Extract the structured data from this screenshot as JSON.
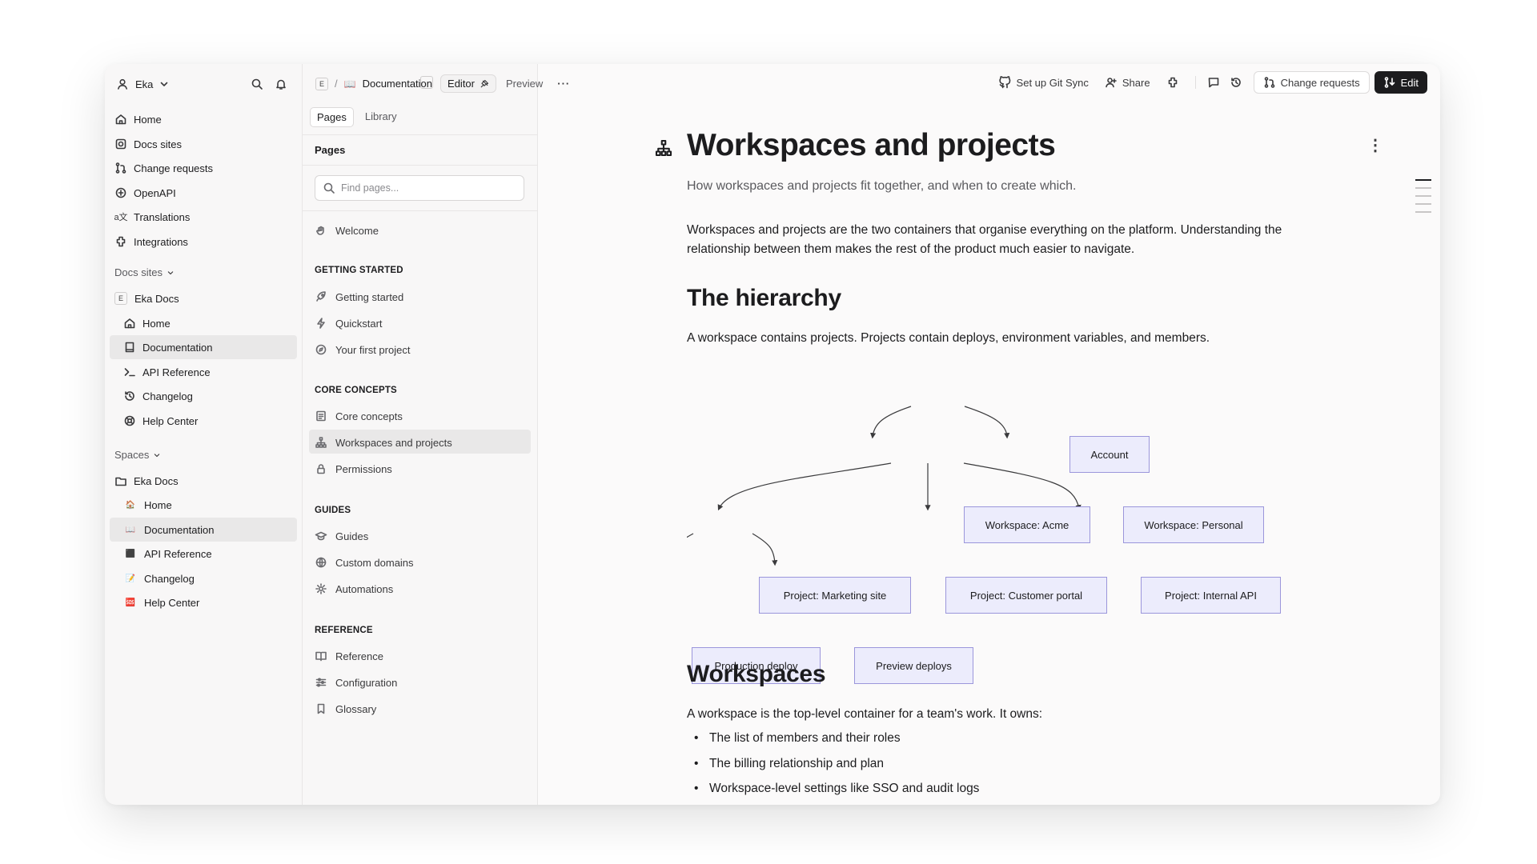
{
  "user": {
    "name": "Eka"
  },
  "sidebar": {
    "nav": [
      {
        "label": "Home",
        "icon": "home-icon"
      },
      {
        "label": "Docs sites",
        "icon": "docs-sites-icon"
      },
      {
        "label": "Change requests",
        "icon": "change-requests-icon"
      },
      {
        "label": "OpenAPI",
        "icon": "openapi-icon"
      },
      {
        "label": "Translations",
        "icon": "translations-icon"
      },
      {
        "label": "Integrations",
        "icon": "integrations-icon"
      }
    ],
    "docs_sites_header": "Docs sites",
    "docs_site": {
      "badge": "E",
      "name": "Eka Docs"
    },
    "docs_site_items": [
      {
        "label": "Home",
        "icon": "home-icon"
      },
      {
        "label": "Documentation",
        "icon": "book-icon",
        "selected": true
      },
      {
        "label": "API Reference",
        "icon": "terminal-icon"
      },
      {
        "label": "Changelog",
        "icon": "history-icon"
      },
      {
        "label": "Help Center",
        "icon": "lifebuoy-icon"
      }
    ],
    "spaces_header": "Spaces",
    "space": {
      "name": "Eka Docs",
      "icon": "folder-icon"
    },
    "space_items": [
      {
        "label": "Home",
        "icon": "🏠"
      },
      {
        "label": "Documentation",
        "icon": "📖",
        "selected": true
      },
      {
        "label": "API Reference",
        "icon": "⬛"
      },
      {
        "label": "Changelog",
        "icon": "📝"
      },
      {
        "label": "Help Center",
        "icon": "🆘"
      }
    ]
  },
  "topbar": {
    "space_badge": "E",
    "separator": "/",
    "space_icon": "📖",
    "space_name": "Documentation",
    "editor_label": "Editor",
    "preview_label": "Preview",
    "more_label": "···",
    "git_sync_label": "Set up Git Sync",
    "share_label": "Share",
    "change_requests_label": "Change requests",
    "edit_label": "Edit"
  },
  "pages_panel": {
    "tabs": [
      {
        "label": "Pages",
        "active": true
      },
      {
        "label": "Library",
        "active": false
      }
    ],
    "title": "Pages",
    "search_placeholder": "Find pages...",
    "welcome": {
      "label": "Welcome",
      "icon": "hand-wave-icon"
    },
    "groups": [
      {
        "title": "GETTING STARTED",
        "items": [
          {
            "label": "Getting started",
            "icon": "rocket-icon"
          },
          {
            "label": "Quickstart",
            "icon": "bolt-icon"
          },
          {
            "label": "Your first project",
            "icon": "compass-icon"
          }
        ]
      },
      {
        "title": "CORE CONCEPTS",
        "items": [
          {
            "label": "Core concepts",
            "icon": "list-doc-icon"
          },
          {
            "label": "Workspaces and projects",
            "icon": "hierarchy-icon",
            "selected": true
          },
          {
            "label": "Permissions",
            "icon": "lock-icon"
          }
        ]
      },
      {
        "title": "GUIDES",
        "items": [
          {
            "label": "Guides",
            "icon": "graduation-cap-icon"
          },
          {
            "label": "Custom domains",
            "icon": "globe-icon"
          },
          {
            "label": "Automations",
            "icon": "cog-icon"
          }
        ]
      },
      {
        "title": "REFERENCE",
        "items": [
          {
            "label": "Reference",
            "icon": "book-open-icon"
          },
          {
            "label": "Configuration",
            "icon": "sliders-icon"
          },
          {
            "label": "Glossary",
            "icon": "bookmark-icon"
          }
        ]
      }
    ]
  },
  "content": {
    "title": "Workspaces and projects",
    "subtitle": "How workspaces and projects fit together, and when to create which.",
    "intro": "Workspaces and projects are the two containers that organise everything on the platform. Understanding the relationship between them makes the rest of the product much easier to navigate.",
    "h_hierarchy": "The hierarchy",
    "hierarchy_text": "A workspace contains projects. Projects contain deploys, environment variables, and members.",
    "diagram": {
      "nodes": {
        "account": "Account",
        "ws_acme": "Workspace: Acme",
        "ws_personal": "Workspace: Personal",
        "proj_marketing": "Project: Marketing site",
        "proj_portal": "Project: Customer portal",
        "proj_api": "Project: Internal API",
        "prod_deploy": "Production deploy",
        "preview_deploys": "Preview deploys"
      }
    },
    "h_workspaces": "Workspaces",
    "workspaces_text": "A workspace is the top-level container for a team's work. It owns:",
    "bullets": [
      "The list of members and their roles",
      "The billing relationship and plan",
      "Workspace-level settings like SSO and audit logs"
    ]
  },
  "colors": {
    "node_fill": "#ececfc",
    "node_border": "#9b96db",
    "selected_bg": "#e9e8e8",
    "edit_button": "#1c1c1e"
  }
}
